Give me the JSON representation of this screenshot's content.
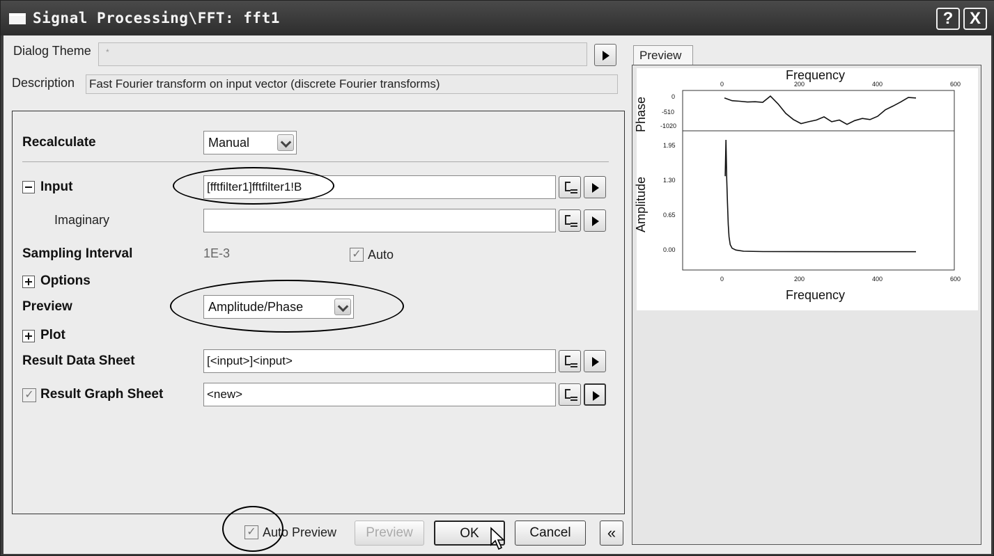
{
  "window": {
    "title": "Signal Processing\\FFT: fft1",
    "help_label": "?",
    "close_label": "X"
  },
  "dialog_theme": {
    "label": "Dialog Theme",
    "value": "*"
  },
  "description": {
    "label": "Description",
    "text": "Fast Fourier transform on input vector (discrete Fourier transforms)"
  },
  "form": {
    "recalculate": {
      "label": "Recalculate",
      "value": "Manual"
    },
    "input": {
      "label": "Input",
      "value": "[fftfilter1]fftfilter1!B"
    },
    "imaginary": {
      "label": "Imaginary",
      "value": ""
    },
    "sampling_interval": {
      "label": "Sampling Interval",
      "value": "1E-3",
      "auto_label": "Auto",
      "auto_checked": true
    },
    "options": {
      "label": "Options"
    },
    "preview": {
      "label": "Preview",
      "value": "Amplitude/Phase"
    },
    "plot": {
      "label": "Plot"
    },
    "result_data_sheet": {
      "label": "Result Data Sheet",
      "value": "[<input>]<input>"
    },
    "result_graph_sheet": {
      "label": "Result Graph Sheet",
      "value": "<new>",
      "checked": true
    }
  },
  "footer": {
    "auto_preview_label": "Auto Preview",
    "auto_preview_checked": true,
    "preview_button": "Preview",
    "ok_button": "OK",
    "cancel_button": "Cancel",
    "collapse_button": "«"
  },
  "preview_panel": {
    "tab_label": "Preview"
  },
  "chart_data": [
    {
      "type": "line",
      "title": "",
      "xlabel": "Frequency",
      "ylabel": "Phase",
      "x_ticks": [
        "0",
        "200",
        "400",
        "600"
      ],
      "y_ticks": [
        "0",
        "-510",
        "-1020"
      ],
      "xlim": [
        0,
        600
      ],
      "ylim": [
        -1300,
        200
      ],
      "series": [
        {
          "x": [
            0,
            20,
            40,
            60,
            80,
            100,
            120,
            140,
            160,
            180,
            200,
            220,
            240,
            260,
            280,
            300,
            320,
            340,
            360,
            380,
            400,
            420,
            440,
            460,
            480,
            500
          ],
          "values": [
            -80,
            -180,
            -200,
            -230,
            -220,
            -240,
            -10,
            -300,
            -650,
            -880,
            -1030,
            -960,
            -900,
            -780,
            -960,
            -900,
            -1060,
            -920,
            -840,
            -880,
            -760,
            -520,
            -380,
            -230,
            -60,
            -80
          ]
        }
      ]
    },
    {
      "type": "line",
      "title": "",
      "xlabel": "Frequency",
      "ylabel": "Amplitude",
      "x_ticks": [
        "0",
        "200",
        "400",
        "600"
      ],
      "y_ticks": [
        "0.00",
        "0.65",
        "1.30",
        "1.95"
      ],
      "xlim": [
        0,
        600
      ],
      "ylim": [
        -0.3,
        2.0
      ],
      "series": [
        {
          "x": [
            2,
            4,
            6,
            8,
            10,
            12,
            15,
            20,
            30,
            50,
            100,
            200,
            300,
            400,
            500
          ],
          "values": [
            1.25,
            1.85,
            1.2,
            0.8,
            0.45,
            0.25,
            0.12,
            0.06,
            0.03,
            0.01,
            0.005,
            0.004,
            0.003,
            0.003,
            0.003
          ]
        }
      ]
    }
  ]
}
